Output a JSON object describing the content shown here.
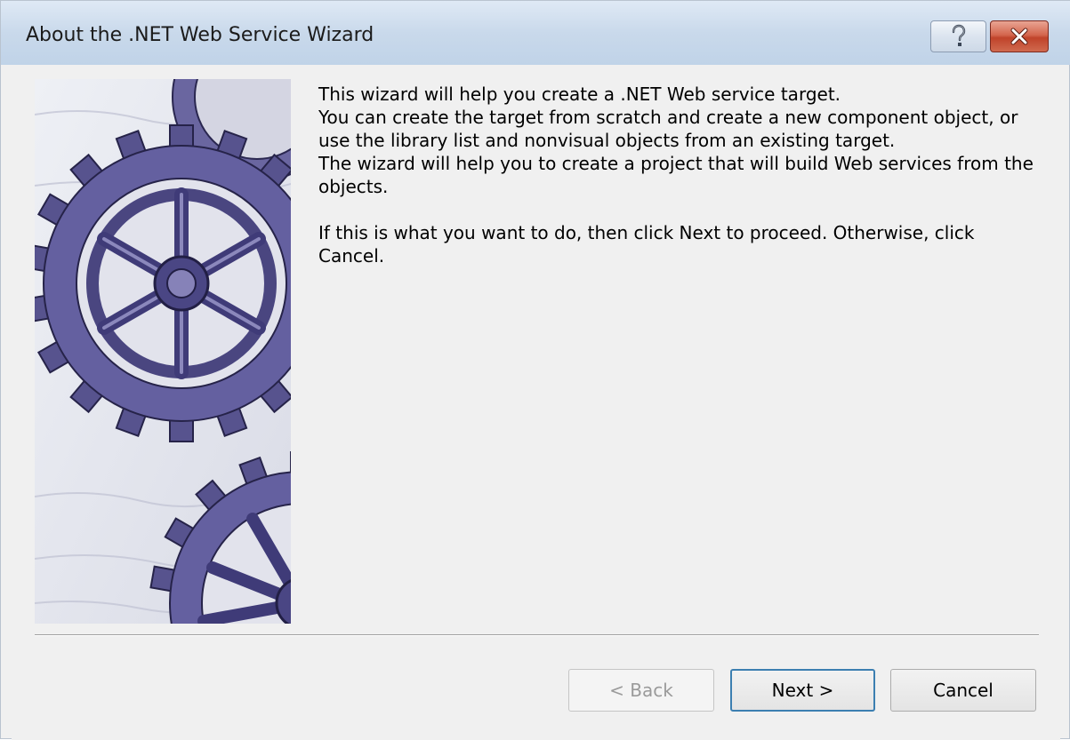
{
  "window": {
    "title": "About the .NET Web Service Wizard",
    "help_glyph": "?",
    "close_glyph": "✕"
  },
  "content": {
    "paragraphs": [
      "This wizard will help you create a .NET Web service target.",
      "You can create the target from scratch and create a new component object, or use the library list and nonvisual objects from an existing target.",
      "The wizard will help you to create a project that will build Web services from the objects.",
      "If this is what you want to do, then click Next to proceed.  Otherwise, click Cancel."
    ]
  },
  "buttons": {
    "back_label": "< Back",
    "next_label": "Next >",
    "cancel_label": "Cancel",
    "back_enabled": false
  },
  "icons": {
    "help": "help-icon",
    "close": "close-icon",
    "art": "gears-illustration"
  },
  "colors": {
    "titlebar": "#c9d9eb",
    "dialog_bg": "#f0f0f0",
    "close_red": "#c0432a",
    "focus_border": "#3c7fb1",
    "gear": "#5e5a94"
  }
}
